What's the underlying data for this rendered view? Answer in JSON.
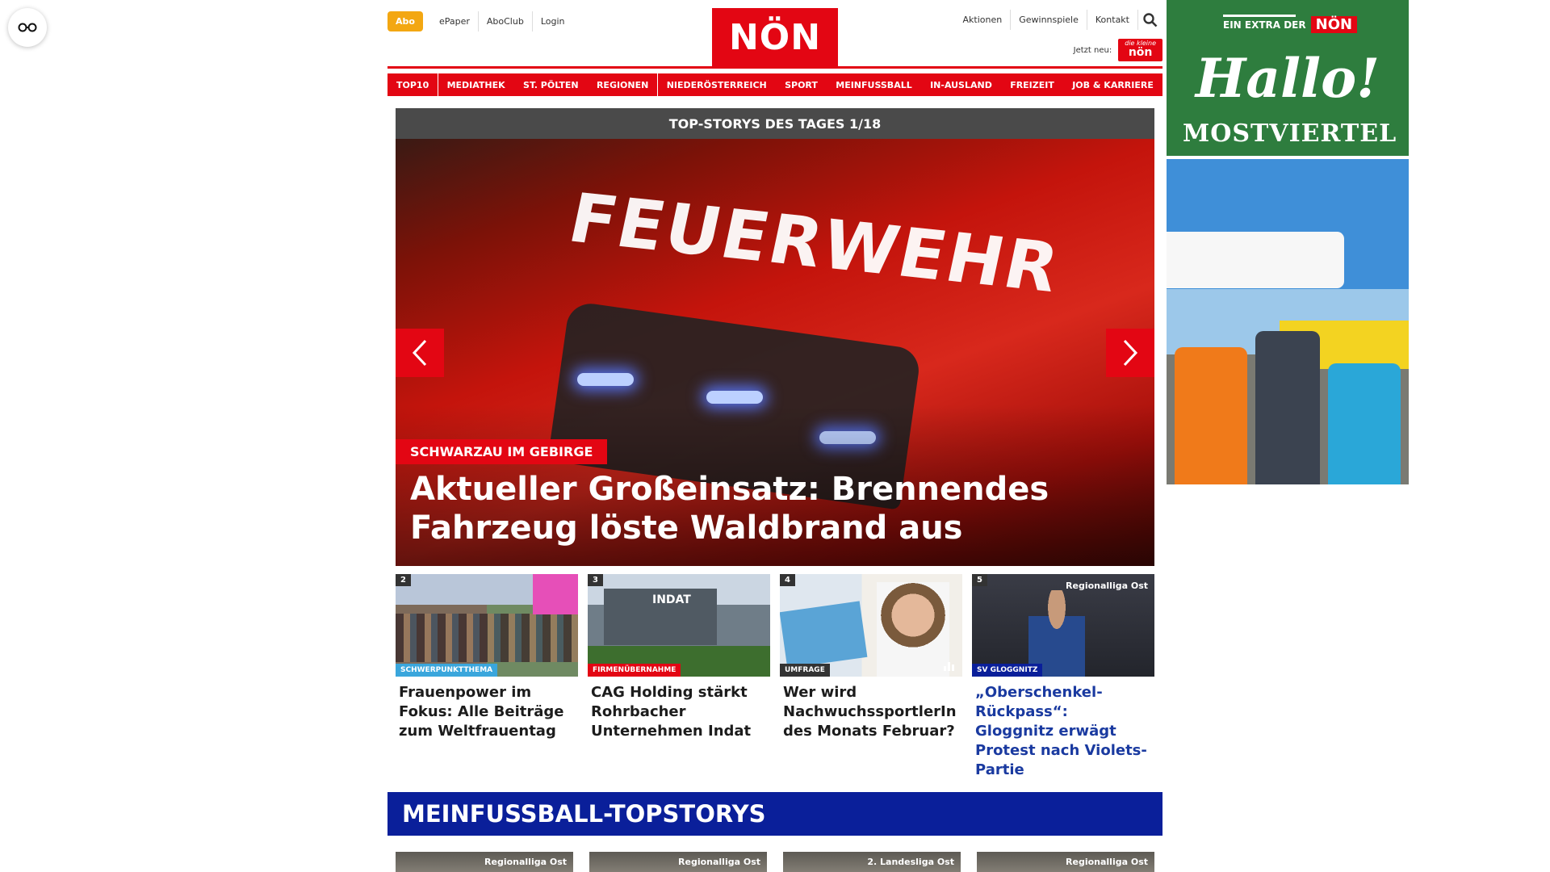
{
  "util_nav_left": {
    "abo": "Abo",
    "epaper": "ePaper",
    "aboclub": "AboClub",
    "login": "Login"
  },
  "logo": "NÖN",
  "util_nav_right": {
    "aktionen": "Aktionen",
    "gewinnspiele": "Gewinnspiele",
    "kontakt": "Kontakt",
    "jetzt_neu": "Jetzt neu:",
    "kleine_non_small": "die kleine",
    "kleine_non": "nön"
  },
  "main_nav": [
    {
      "label": "TOP10"
    },
    {
      "label": "MEDIATHEK"
    },
    {
      "label": "ST. PÖLTEN"
    },
    {
      "label": "REGIONEN"
    },
    {
      "label": "NIEDERÖSTERREICH"
    },
    {
      "label": "SPORT"
    },
    {
      "label": "MEINFUSSBALL"
    },
    {
      "label": "IN-AUSLAND"
    },
    {
      "label": "FREIZEIT"
    },
    {
      "label": "JOB & KARRIERE"
    }
  ],
  "hero": {
    "header": "TOP-STORYS DES TAGES 1/18",
    "image_text": "FEUERWEHR",
    "kicker": "SCHWARZAU IM GEBIRGE",
    "title": "Aktueller Großeinsatz: Brennendes Fahrzeug löste Waldbrand aus"
  },
  "teasers": [
    {
      "num": "2",
      "tag": "SCHWERPUNKTTHEMA",
      "tag_color": "#3aa6dc",
      "badge": "",
      "title": "Frauenpower im Fokus: Alle Beiträge zum Weltfrauentag"
    },
    {
      "num": "3",
      "tag": "FIRMENÜBERNAHME",
      "tag_color": "#e30613",
      "badge": "",
      "image_text": "INDAT",
      "title": "CAG Holding stärkt Rohrbacher Unternehmen Indat"
    },
    {
      "num": "4",
      "tag": "UMFRAGE",
      "tag_color": "#333333",
      "badge": "",
      "title": "Wer wird NachwuchssportlerIn des Monats Februar?"
    },
    {
      "num": "5",
      "tag": "SV GLOGGNITZ",
      "tag_color": "#0a1f9a",
      "badge": "Regionalliga Ost",
      "title": "„Oberschenkel-Rückpass“: Gloggnitz erwägt Protest nach Violets-Partie"
    }
  ],
  "section": {
    "title": "MEINFUSSBALL-TOPSTORYS",
    "badges": [
      "Regionalliga Ost",
      "Regionalliga Ost",
      "2. Landesliga Ost",
      "Regionalliga Ost"
    ]
  },
  "ad": {
    "extra": "EIN EXTRA DER",
    "extra_logo": "NÖN",
    "hallo": "Hallo!",
    "region": "MOSTVIERTEL"
  },
  "colors": {
    "brand_red": "#e30613",
    "section_blue": "#0a1f9a",
    "abo_orange": "#f3a712",
    "ad_green": "#2e7d3e"
  }
}
